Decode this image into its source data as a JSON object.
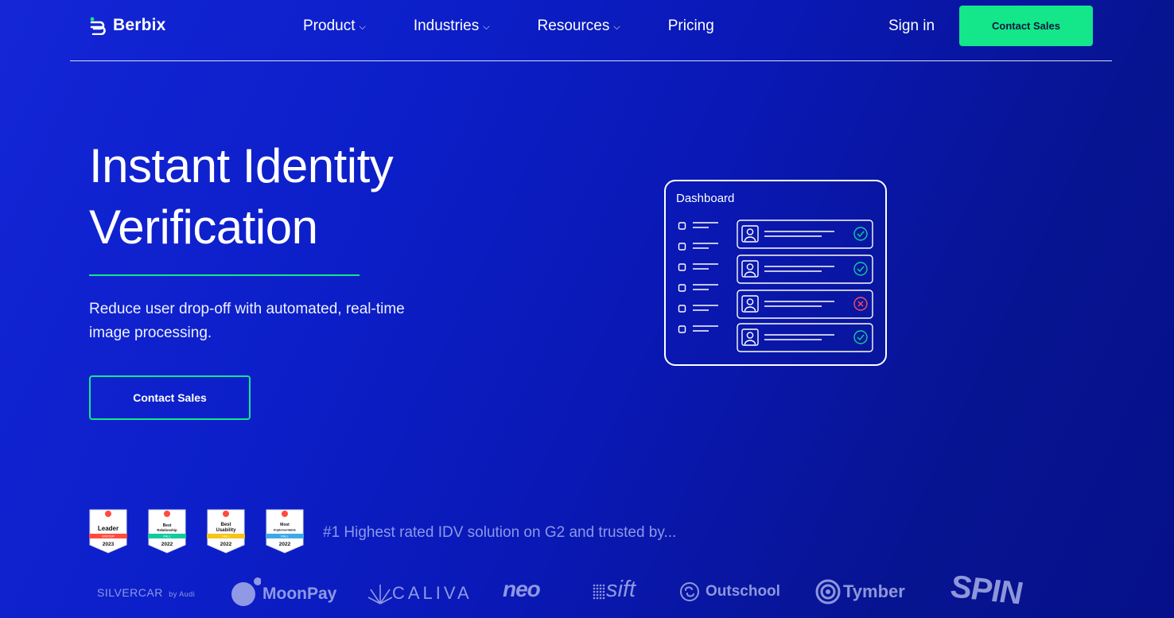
{
  "brand": {
    "name": "Berbix"
  },
  "nav": {
    "items": [
      {
        "label": "Product",
        "has_dropdown": true
      },
      {
        "label": "Industries",
        "has_dropdown": true
      },
      {
        "label": "Resources",
        "has_dropdown": true
      },
      {
        "label": "Pricing",
        "has_dropdown": false
      }
    ],
    "dropdown_glyph": "⌵",
    "signin_label": "Sign in",
    "cta_label": "Contact Sales"
  },
  "hero": {
    "title_line1": "Instant Identity",
    "title_line2": "Verification",
    "subtitle": "Reduce user drop-off with automated, real-time image processing.",
    "cta_label": "Contact Sales"
  },
  "dashboard": {
    "title": "Dashboard",
    "rows": [
      {
        "status": "verified"
      },
      {
        "status": "verified"
      },
      {
        "status": "rejected"
      },
      {
        "status": "verified"
      }
    ]
  },
  "badges": [
    {
      "title": "Leader",
      "season": "WINTER",
      "year": "2023",
      "band_color": "#ff4b3e"
    },
    {
      "title": "Best Relationship",
      "season": "FALL",
      "year": "2022",
      "band_color": "#14c9a0"
    },
    {
      "title": "Best Usability",
      "season": "FALL",
      "year": "2022",
      "band_color": "#f5c518"
    },
    {
      "title": "Most Implementable",
      "season": "FALL",
      "year": "2022",
      "band_color": "#3fa9e8"
    }
  ],
  "trust_text": "#1 Highest rated IDV solution on G2 and trusted by...",
  "customers": {
    "silvercar": "SILVERCAR",
    "silvercar_suffix": "by Audi",
    "moonpay": "MoonPay",
    "caliva": "CALIVA",
    "neo": "neo",
    "sift": "sift",
    "outschool": "Outschool",
    "tymber": "Tymber",
    "spin": "SPIN"
  },
  "colors": {
    "accent": "#14e68a",
    "success": "#14c9a0",
    "error": "#ff4b5c"
  }
}
